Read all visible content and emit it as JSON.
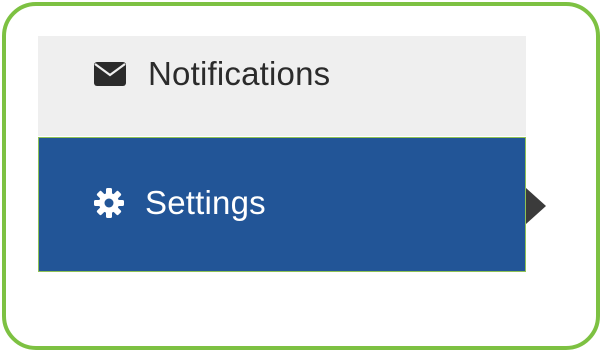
{
  "menu": {
    "items": [
      {
        "label": "Notifications",
        "icon": "envelope-icon",
        "active": false
      },
      {
        "label": "Settings",
        "icon": "gear-icon",
        "active": true
      }
    ]
  },
  "colors": {
    "frame_border": "#7dc142",
    "inactive_bg": "#efefef",
    "active_bg": "#225597",
    "active_text": "#ffffff",
    "inactive_text": "#2b2b2b"
  }
}
